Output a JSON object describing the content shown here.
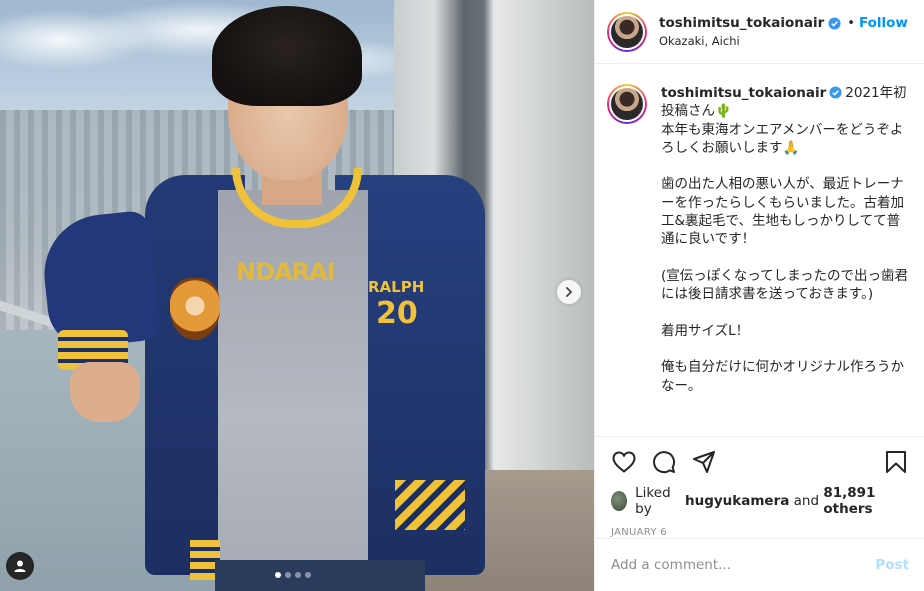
{
  "post": {
    "username": "toshimitsu_tokaionair",
    "location": "Okazaki, Aichi",
    "follow_label": "Follow",
    "bullet": "•",
    "caption_lead": "2021年初投稿さん",
    "caption_emoji_1": "🌵",
    "caption_body_1": "本年も東海オンエアメンバーをどうぞよろしくお願いします",
    "caption_emoji_2": "🙏",
    "caption_body_2": "\n\n歯の出た人相の悪い人が、最近トレーナーを作ったらしくもらいました。古着加工&裏起毛で、生地もしっかりしてて普通に良いです！\n\n(宣伝っぽくなってしまったので出っ歯君には後日請求書を送っておきます。)\n\n着用サイズL！\n\n俺も自分だけに何かオリジナル作ろうかなー。"
  },
  "photo": {
    "print_text": "NDARAI",
    "patch_word": "RALPH",
    "patch_number": "20",
    "dots_total": 4,
    "dots_active": 1
  },
  "engagement": {
    "liked_by_prefix": "Liked by",
    "liked_by_user": "hugyukamera",
    "liked_by_and": "and",
    "likes_count": "81,891 others",
    "date": "JANUARY 6"
  },
  "comment_box": {
    "placeholder": "Add a comment...",
    "post_label": "Post"
  },
  "icons": [
    "heart-icon",
    "comment-icon",
    "share-icon",
    "save-icon",
    "chevron-right-icon",
    "user-tag-icon",
    "verified-icon"
  ],
  "colors": {
    "accent": "#0095f6",
    "post_disabled": "#b2dffc",
    "text": "#262626",
    "muted": "#8e8e8e"
  }
}
